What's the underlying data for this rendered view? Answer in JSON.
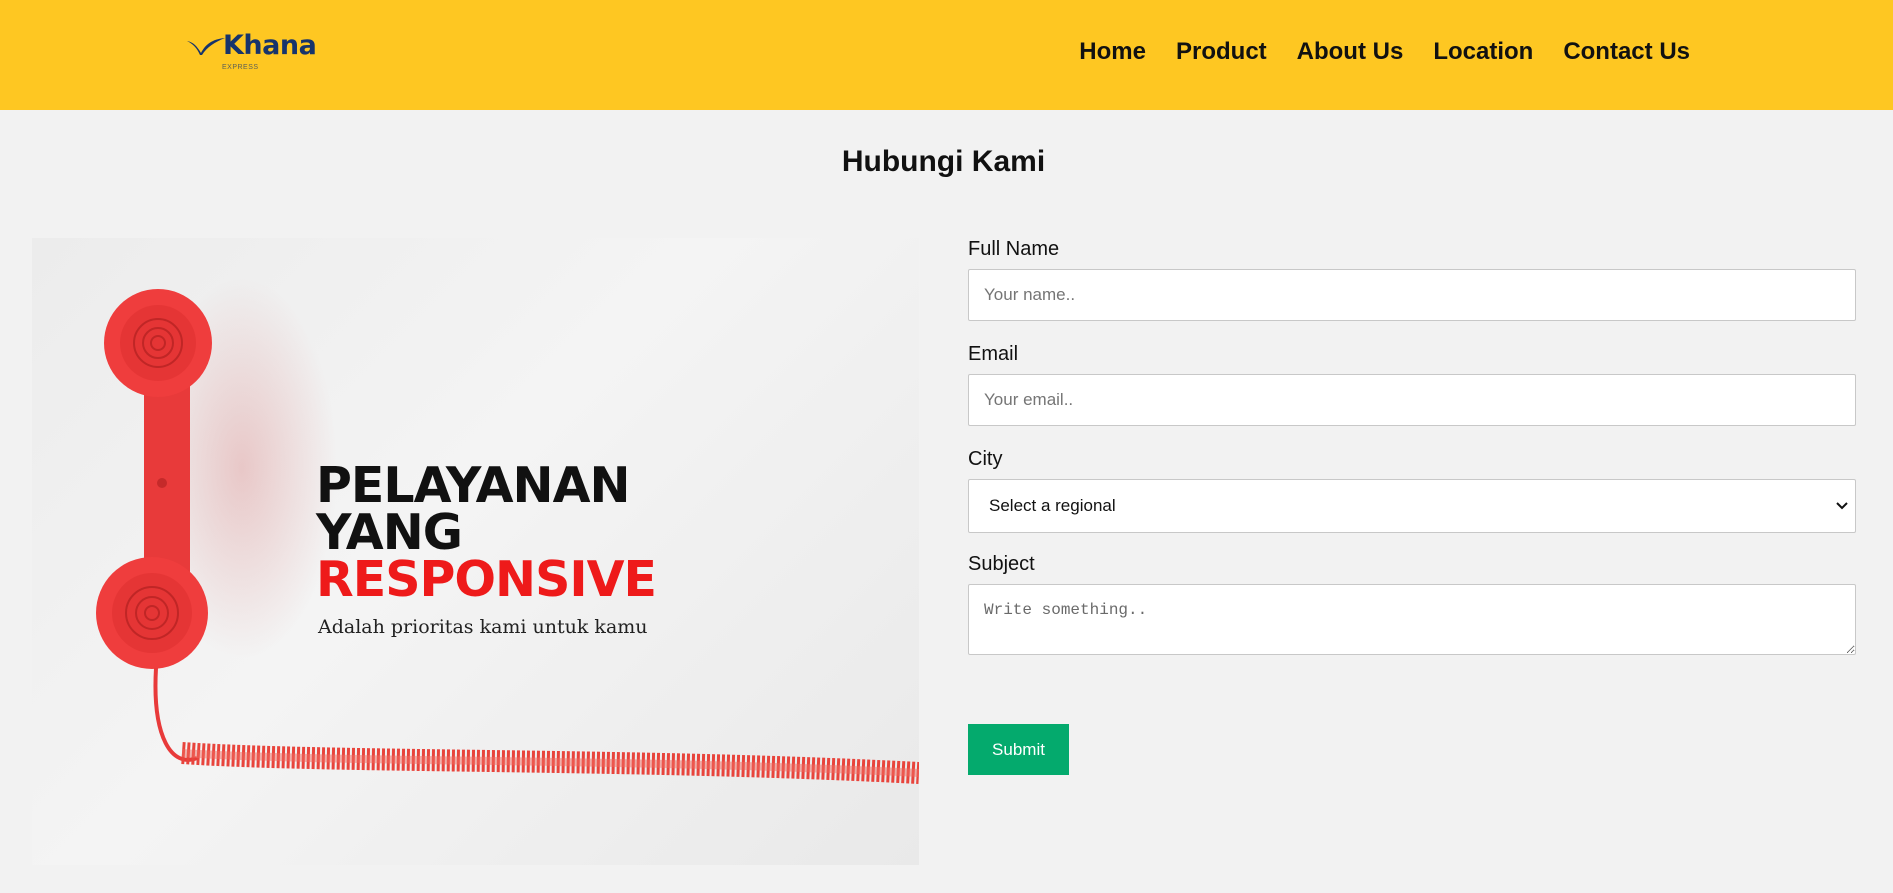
{
  "header": {
    "logo_text": "Khana",
    "logo_sub": "EXPRESS",
    "nav": [
      "Home",
      "Product",
      "About Us",
      "Location",
      "Contact Us"
    ],
    "colors": {
      "background": "#fec722",
      "logo": "#17346b"
    }
  },
  "page": {
    "title": "Hubungi Kami"
  },
  "promo": {
    "line1": "PELAYANAN",
    "line2": "YANG",
    "line3": "RESPONSIVE",
    "tagline": "Adalah prioritas kami untuk kamu",
    "accent_color": "#ee1a1a",
    "icon": "telephone-handset-icon"
  },
  "form": {
    "full_name": {
      "label": "Full Name",
      "placeholder": "Your name.."
    },
    "email": {
      "label": "Email",
      "placeholder": "Your email.."
    },
    "city": {
      "label": "City",
      "selected": "Select a regional"
    },
    "subject": {
      "label": "Subject",
      "placeholder": "Write something.."
    },
    "submit_label": "Submit",
    "submit_color": "#04aa6d"
  }
}
